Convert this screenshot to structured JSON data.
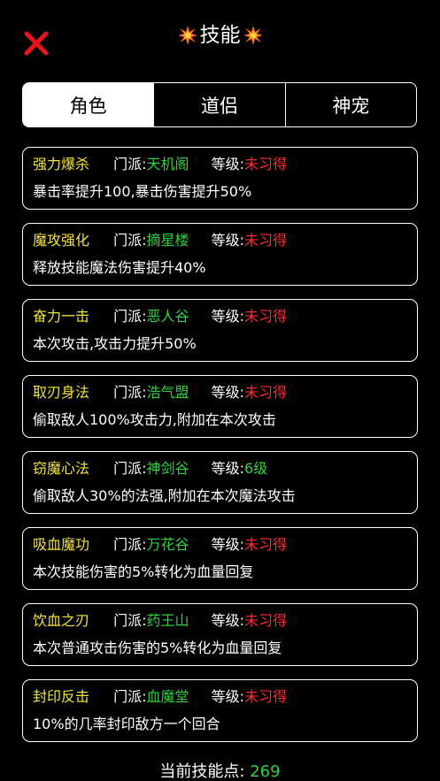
{
  "header": {
    "title": "技能",
    "close_icon": "close-x-icon",
    "title_icon": "collision-burst-icon"
  },
  "tabs": [
    {
      "label": "角色",
      "active": true
    },
    {
      "label": "道侣",
      "active": false
    },
    {
      "label": "神宠",
      "active": false
    }
  ],
  "labels": {
    "school": "门派:",
    "level": "等级:"
  },
  "skills": [
    {
      "name": "强力爆杀",
      "school": "天机阁",
      "level": "未习得",
      "learned": false,
      "desc": "暴击率提升100,暴击伤害提升50%"
    },
    {
      "name": "魔攻强化",
      "school": "摘星楼",
      "level": "未习得",
      "learned": false,
      "desc": "释放技能魔法伤害提升40%"
    },
    {
      "name": "奋力一击",
      "school": "恶人谷",
      "level": "未习得",
      "learned": false,
      "desc": "本次攻击,攻击力提升50%"
    },
    {
      "name": "取刃身法",
      "school": "浩气盟",
      "level": "未习得",
      "learned": false,
      "desc": "偷取敌人100%攻击力,附加在本次攻击"
    },
    {
      "name": "窃魔心法",
      "school": "神剑谷",
      "level": "6级",
      "learned": true,
      "desc": "偷取敌人30%的法强,附加在本次魔法攻击"
    },
    {
      "name": "吸血魔功",
      "school": "万花谷",
      "level": "未习得",
      "learned": false,
      "desc": "本次技能伤害的5%转化为血量回复"
    },
    {
      "name": "饮血之刃",
      "school": "药王山",
      "level": "未习得",
      "learned": false,
      "desc": "本次普通攻击伤害的5%转化为血量回复"
    },
    {
      "name": "封印反击",
      "school": "血魔堂",
      "level": "未习得",
      "learned": false,
      "desc": "10%的几率封印敌方一个回合"
    }
  ],
  "footer": {
    "points_label": "当前技能点: ",
    "points_value": "269"
  },
  "colors": {
    "background": "#000000",
    "skill_name": "#f2e33b",
    "school": "#2ed13c",
    "not_learned": "#ff2a2a",
    "close": "#e8141c"
  }
}
